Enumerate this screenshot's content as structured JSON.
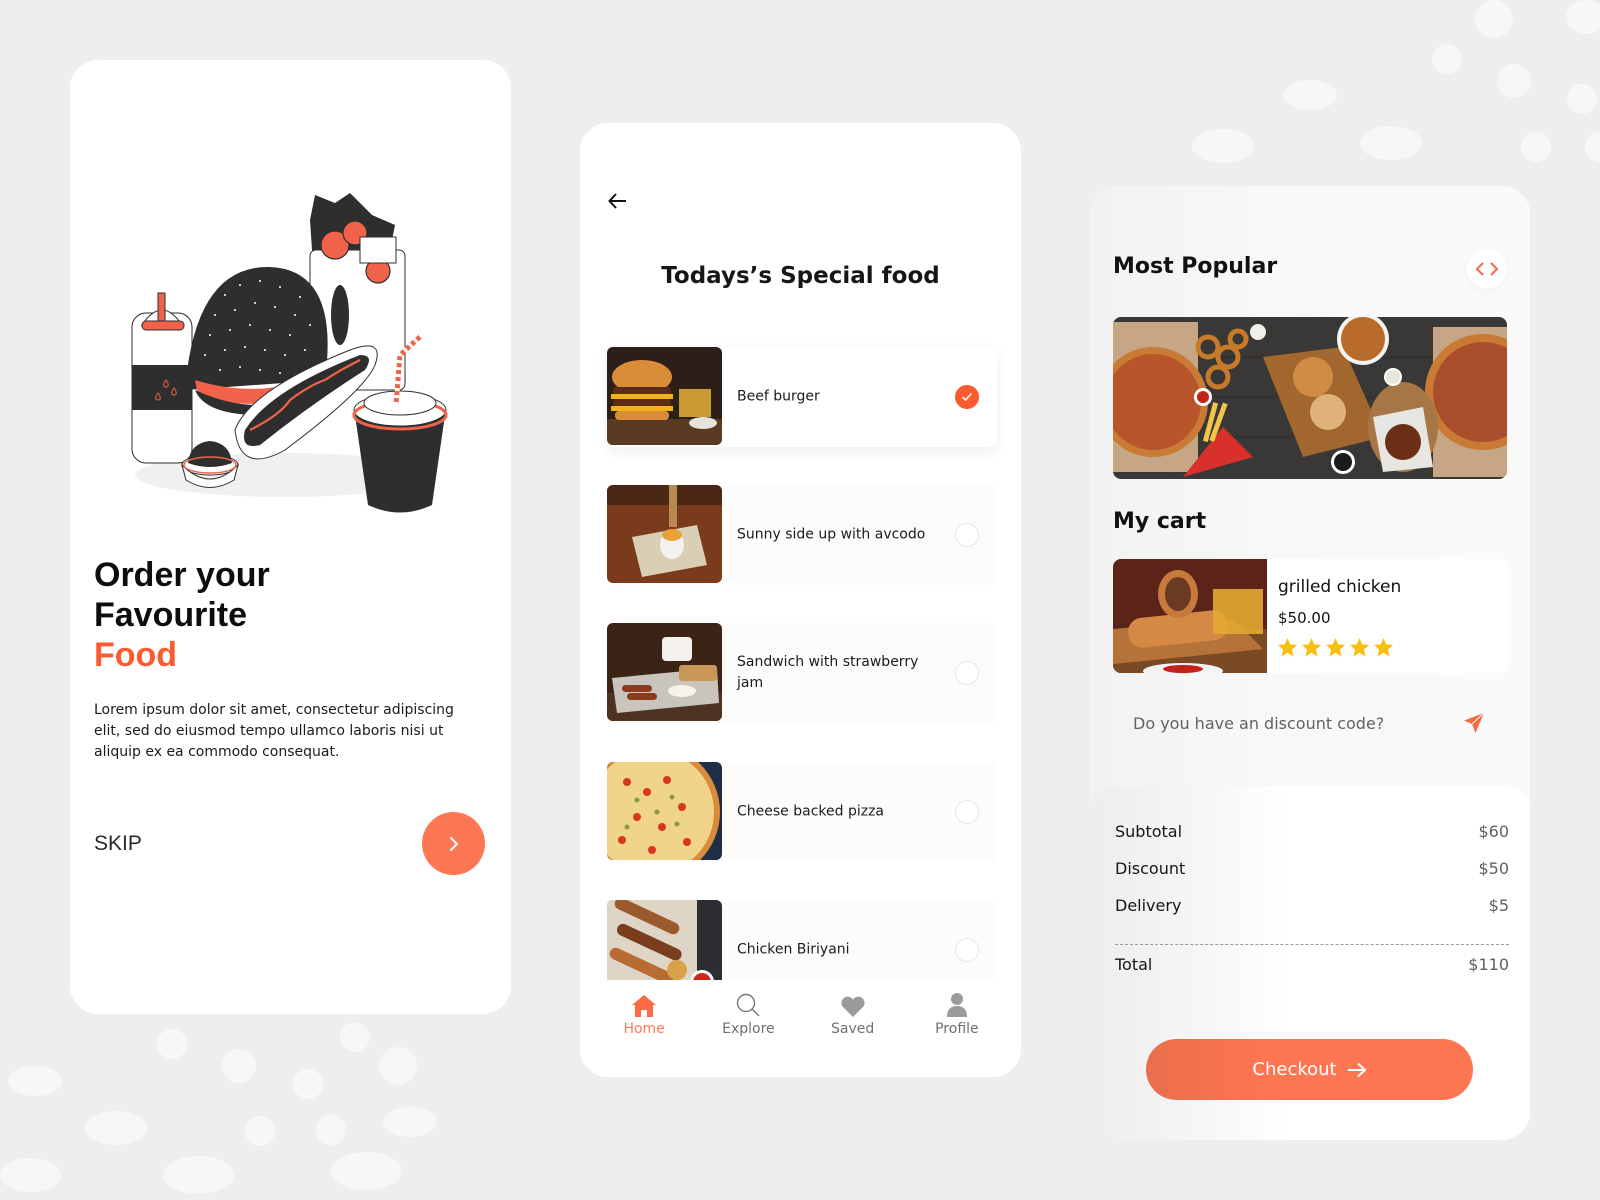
{
  "theme": {
    "accent": "#fb5b2f",
    "accent_soft": "#fd7754",
    "star": "#fbbf0e",
    "background": "#eeeeee"
  },
  "onboarding": {
    "illustration": "fast-food-illustration",
    "title_line1": "Order your",
    "title_line2": "Favourite",
    "title_accent": "Food",
    "description": "Lorem ipsum dolor sit amet, consectetur adipiscing elit, sed do eiusmod tempo ullamco laboris nisi ut aliquip ex ea commodo consequat.",
    "skip_label": "SKIP",
    "next_icon": "chevron-right-icon"
  },
  "special": {
    "back_icon": "arrow-left-icon",
    "title": "Todays’s Special food",
    "items": [
      {
        "name": "Beef burger",
        "image": "beef-burger-photo",
        "selected": true
      },
      {
        "name": "Sunny side up with avcodo",
        "image": "egg-breakfast-photo",
        "selected": false
      },
      {
        "name": "Sandwich with strawberry jam",
        "image": "breakfast-plate-photo",
        "selected": false
      },
      {
        "name": "Cheese backed pizza",
        "image": "pizza-photo",
        "selected": false
      },
      {
        "name": "Chicken Biriyani",
        "image": "kebab-platter-photo",
        "selected": false
      }
    ],
    "nav": [
      {
        "label": "Home",
        "icon": "home-icon",
        "active": true
      },
      {
        "label": "Explore",
        "icon": "search-icon",
        "active": false
      },
      {
        "label": "Saved",
        "icon": "heart-icon",
        "active": false
      },
      {
        "label": "Profile",
        "icon": "user-icon",
        "active": false
      }
    ]
  },
  "cart": {
    "popular_title": "Most Popular",
    "popular_image": "fast-food-spread-photo",
    "arrows_icon": "code-arrows-icon",
    "cart_title": "My cart",
    "item": {
      "name": "grilled chicken",
      "price": "$50.00",
      "rating": 5,
      "rating_max": 5,
      "image": "chicken-wrap-photo"
    },
    "discount_placeholder": "Do you have an discount code?",
    "discount_value": "",
    "summary": [
      {
        "label": "Subtotal",
        "value": "$60"
      },
      {
        "label": "Discount",
        "value": "$50"
      },
      {
        "label": "Delivery",
        "value": "$5"
      }
    ],
    "total_label": "Total",
    "total_value": "$110",
    "checkout_label": "Checkout"
  }
}
